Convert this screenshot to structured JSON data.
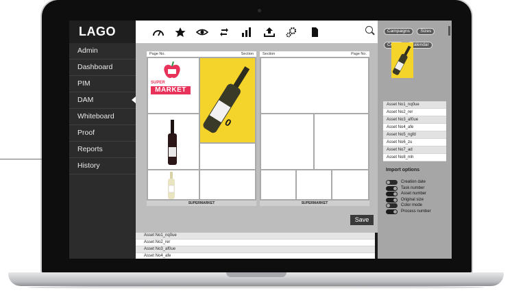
{
  "app": {
    "logo": "LAGO"
  },
  "sidebar": {
    "items": [
      {
        "label": "Admin"
      },
      {
        "label": "Dashboard"
      },
      {
        "label": "PIM"
      },
      {
        "label": "DAM",
        "active": true
      },
      {
        "label": "Whiteboard"
      },
      {
        "label": "Proof"
      },
      {
        "label": "Reports"
      },
      {
        "label": "History"
      }
    ]
  },
  "toolbar": {
    "icons": [
      "dashboard-gauge-icon",
      "star-icon",
      "eye-icon",
      "sync-icon",
      "bar-chart-icon",
      "upload-icon",
      "settings-gears-icon",
      "document-icon",
      "search-icon"
    ]
  },
  "tags": [
    "Campaigns",
    "Sizes",
    "Colors",
    "Calendar"
  ],
  "layout_pages": [
    {
      "header_left": "Page No.",
      "header_right": "Section",
      "footer": "SUPERMARKET"
    },
    {
      "header_left": "Section",
      "header_right": "Page No.",
      "footer": "SUPERMARKET"
    }
  ],
  "logo_text": {
    "super": "SUPER",
    "market": "MARKET"
  },
  "bottle_label": "0",
  "save_label": "Save",
  "bottom_list": [
    "Asset No1_nq0ue",
    "Asset No2_rer",
    "Asset No3_af0ue",
    "Asset No4_afe"
  ],
  "asset_list": [
    "Asset No1_nq0ue",
    "Asset No2_rer",
    "Asset No3_af0ue",
    "Asset No4_afe",
    "Asset No5_ngfd",
    "Asset No6_zu",
    "Asset No7_ad",
    "Asset No8_mh"
  ],
  "import_options": {
    "title": "Import options",
    "options": [
      {
        "label": "Creation date",
        "on": false
      },
      {
        "label": "Task number",
        "on": true
      },
      {
        "label": "Asset number",
        "on": true
      },
      {
        "label": "Original size",
        "on": true
      },
      {
        "label": "Color mode",
        "on": false
      },
      {
        "label": "Process number",
        "on": true
      }
    ]
  }
}
